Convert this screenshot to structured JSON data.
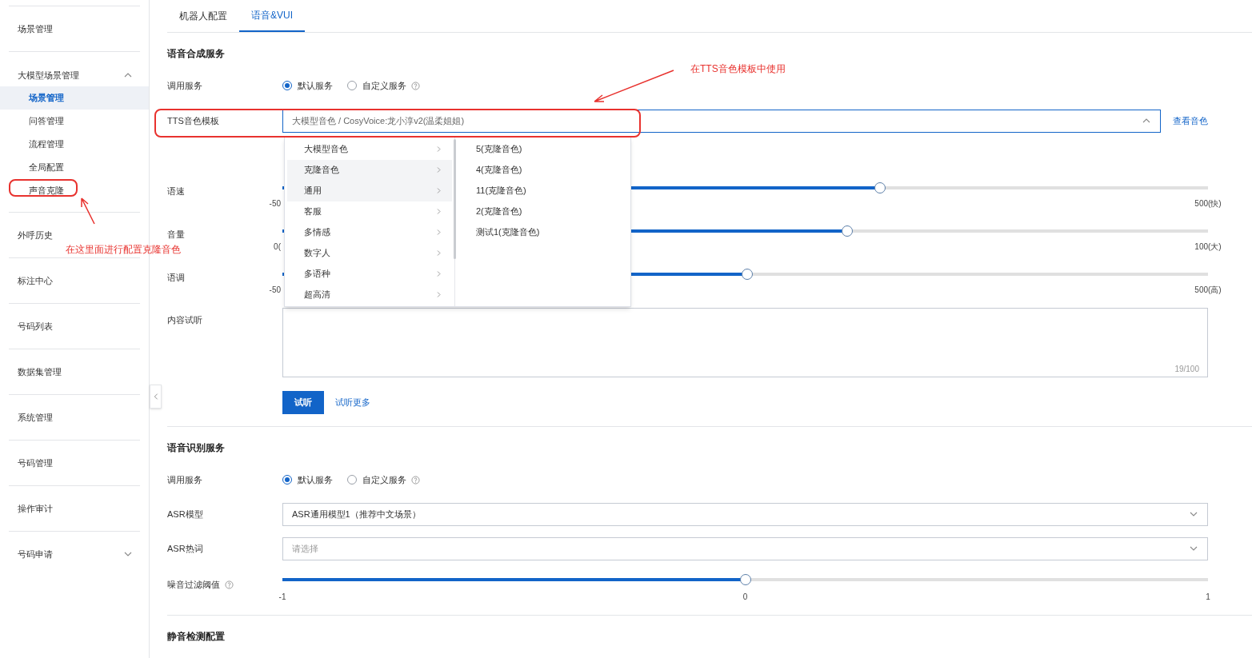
{
  "sidebar": {
    "items": [
      {
        "kind": "link",
        "label": "场景管理"
      },
      {
        "kind": "folder",
        "label": "大模型场景管理",
        "expanded": true,
        "children": [
          {
            "label": "场景管理",
            "selected": true
          },
          {
            "label": "问答管理",
            "selected": false
          },
          {
            "label": "流程管理",
            "selected": false
          },
          {
            "label": "全局配置",
            "selected": false
          },
          {
            "label": "声音克隆",
            "selected": false
          }
        ]
      },
      {
        "kind": "link",
        "label": "外呼历史"
      },
      {
        "kind": "link",
        "label": "标注中心"
      },
      {
        "kind": "link",
        "label": "号码列表"
      },
      {
        "kind": "link",
        "label": "数据集管理"
      },
      {
        "kind": "link",
        "label": "系统管理"
      },
      {
        "kind": "link",
        "label": "号码管理"
      },
      {
        "kind": "link",
        "label": "操作审计"
      },
      {
        "kind": "folder",
        "label": "号码申请",
        "expanded": false
      }
    ]
  },
  "tabs": [
    {
      "label": "机器人配置",
      "selected": false
    },
    {
      "label": "语音&VUI",
      "selected": true
    }
  ],
  "sections": [
    {
      "title": "语音合成服务",
      "rows": [
        {
          "kind": "radio",
          "label": "调用服务",
          "options": [
            {
              "label": "默认服务",
              "selected": true,
              "help": false
            },
            {
              "label": "自定义服务",
              "selected": false,
              "help": true
            }
          ]
        },
        {
          "kind": "select",
          "label": "TTS音色模板",
          "value": "大模型音色 / CosyVoice:龙小淳v2(温柔姐姐)",
          "open": true,
          "link": "查看音色"
        },
        {
          "kind": "slider",
          "label": "语速",
          "level": 0.646,
          "min": "-50",
          "max": "500(快)"
        },
        {
          "kind": "slider",
          "label": "音量",
          "level": 0.61,
          "min": "0(",
          "max": "100(大)"
        },
        {
          "kind": "slider",
          "label": "语调",
          "level": 0.502,
          "min": "-50",
          "max": "500(高)"
        },
        {
          "kind": "textarea",
          "label": "内容试听",
          "count": "19/100"
        },
        {
          "kind": "actions",
          "button": "试听",
          "link": "试听更多"
        }
      ]
    },
    {
      "title": "语音识别服务",
      "rows": [
        {
          "kind": "radio",
          "label": "调用服务",
          "options": [
            {
              "label": "默认服务",
              "selected": true,
              "help": false
            },
            {
              "label": "自定义服务",
              "selected": false,
              "help": true
            }
          ]
        },
        {
          "kind": "select",
          "label": "ASR模型",
          "value": "ASR通用模型1（推荐中文场景）",
          "open": false
        },
        {
          "kind": "select",
          "label": "ASR热词",
          "placeholder": "请选择",
          "open": false
        },
        {
          "kind": "ticks",
          "label": "噪音过滤阈值",
          "help": true,
          "level": 0.5,
          "ticks": [
            "-1",
            "0",
            "1"
          ]
        }
      ]
    },
    {
      "title": "静音检测配置"
    }
  ],
  "dropdown": {
    "categories": [
      {
        "label": "大模型音色",
        "highlighted": false
      },
      {
        "label": "克隆音色",
        "highlighted": true
      },
      {
        "label": "通用",
        "highlighted": true
      },
      {
        "label": "客服",
        "highlighted": false
      },
      {
        "label": "多情感",
        "highlighted": false
      },
      {
        "label": "数字人",
        "highlighted": false
      },
      {
        "label": "多语种",
        "highlighted": false
      },
      {
        "label": "超高清",
        "highlighted": false
      }
    ],
    "options": [
      "5(克隆音色)",
      "4(克隆音色)",
      "11(克隆音色)",
      "2(克隆音色)",
      "测试1(克隆音色)"
    ]
  },
  "annotations": [
    "在TTS音色模板中使用",
    "在这里面进行配置克隆音色"
  ]
}
